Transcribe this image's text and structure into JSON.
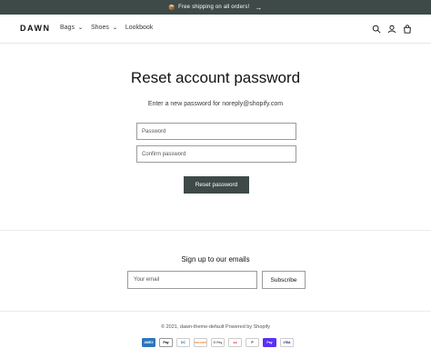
{
  "announcement": {
    "text": "Free shipping on all orders!",
    "emoji": "📦",
    "arrow": "→"
  },
  "header": {
    "logo": "DAWN",
    "nav": [
      {
        "label": "Bags",
        "has_dropdown": true
      },
      {
        "label": "Shoes",
        "has_dropdown": true
      },
      {
        "label": "Lookbook",
        "has_dropdown": false
      }
    ],
    "icons": [
      "search-icon",
      "account-icon",
      "cart-icon"
    ]
  },
  "main": {
    "title": "Reset account password",
    "subtitle": "Enter a new password for noreply@shopify.com",
    "password_placeholder": "Password",
    "confirm_placeholder": "Confirm password",
    "submit_label": "Reset password"
  },
  "newsletter": {
    "title": "Sign up to our emails",
    "email_placeholder": "Your email",
    "subscribe_label": "Subscribe"
  },
  "footer": {
    "copyright": "© 2021, dawn-theme-default Powered by Shopify",
    "payments": [
      {
        "name": "American Express",
        "label": "AMEX",
        "bg": "#2e77bc",
        "fg": "#ffffff"
      },
      {
        "name": "Apple Pay",
        "label": "Pay",
        "bg": "#ffffff",
        "fg": "#000000"
      },
      {
        "name": "Diners Club",
        "label": "DC",
        "bg": "#ffffff",
        "fg": "#0079be"
      },
      {
        "name": "Discover",
        "label": "DISCOVER",
        "bg": "#ffffff",
        "fg": "#f58220"
      },
      {
        "name": "Google Pay",
        "label": "G Pay",
        "bg": "#ffffff",
        "fg": "#5f6368"
      },
      {
        "name": "Mastercard",
        "label": "●●",
        "bg": "#ffffff",
        "fg": "#eb001b"
      },
      {
        "name": "PayPal",
        "label": "P",
        "bg": "#ffffff",
        "fg": "#003087"
      },
      {
        "name": "Shop Pay",
        "label": "Pay",
        "bg": "#5a31f4",
        "fg": "#ffffff"
      },
      {
        "name": "Visa",
        "label": "VISA",
        "bg": "#ffffff",
        "fg": "#1a1f71"
      }
    ]
  },
  "colors": {
    "accent": "#3d4a47",
    "border": "#9b9b9b"
  }
}
